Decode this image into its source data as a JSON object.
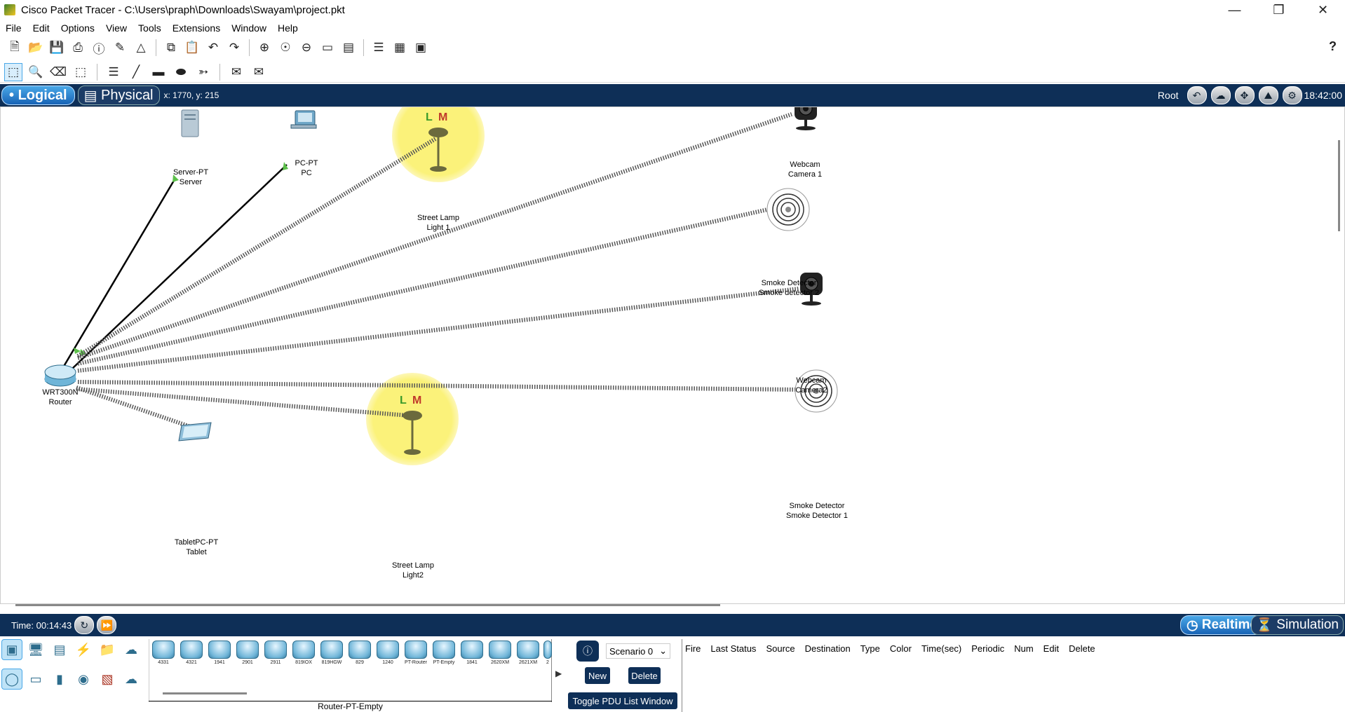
{
  "window": {
    "title": "Cisco Packet Tracer - C:\\Users\\praph\\Downloads\\Swayam\\project.pkt"
  },
  "menu": [
    "File",
    "Edit",
    "Options",
    "View",
    "Tools",
    "Extensions",
    "Window",
    "Help"
  ],
  "modebar": {
    "logical": "Logical",
    "physical": "Physical",
    "coords": "x: 1770, y: 215",
    "root": "Root",
    "clock": "18:42:00"
  },
  "devices": {
    "server": {
      "type": "Server-PT",
      "name": "Server"
    },
    "pc": {
      "type": "PC-PT",
      "name": "PC"
    },
    "lamp1": {
      "type": "Street Lamp",
      "name": "Light 1",
      "l": "L",
      "m": "M"
    },
    "webcam1": {
      "type": "Webcam",
      "name": "Camera 1"
    },
    "smoke2": {
      "type": "Smoke Detector",
      "name": "Smoke detector 2"
    },
    "webcam2": {
      "type": "Webcam",
      "name": "Camera2"
    },
    "smoke1": {
      "type": "Smoke Detector",
      "name": "Smoke Detector 1"
    },
    "router": {
      "type": "WRT300N",
      "name": "Router"
    },
    "tablet": {
      "type": "TabletPC-PT",
      "name": "Tablet"
    },
    "lamp2": {
      "type": "Street Lamp",
      "name": "Light2",
      "l": "L",
      "m": "M"
    }
  },
  "bottombar": {
    "time": "Time: 00:14:43",
    "realtime": "Realtime",
    "simulation": "Simulation"
  },
  "device_models": [
    "4331",
    "4321",
    "1941",
    "2901",
    "2911",
    "819IOX",
    "819HGW",
    "829",
    "1240",
    "PT-Router",
    "PT-Empty",
    "1841",
    "2620XM",
    "2621XM",
    "2"
  ],
  "device_caption": "Router-PT-Empty",
  "pdu": {
    "scenario": "Scenario 0",
    "new": "New",
    "delete": "Delete",
    "toggle": "Toggle PDU List Window",
    "columns": [
      "Fire",
      "Last Status",
      "Source",
      "Destination",
      "Type",
      "Color",
      "Time(sec)",
      "Periodic",
      "Num",
      "Edit",
      "Delete"
    ]
  },
  "colors": {
    "navy": "#0e2f57",
    "accent": "#1763b5",
    "link_green": "#5cc04a",
    "lamp_glow": "#fbf27a"
  }
}
